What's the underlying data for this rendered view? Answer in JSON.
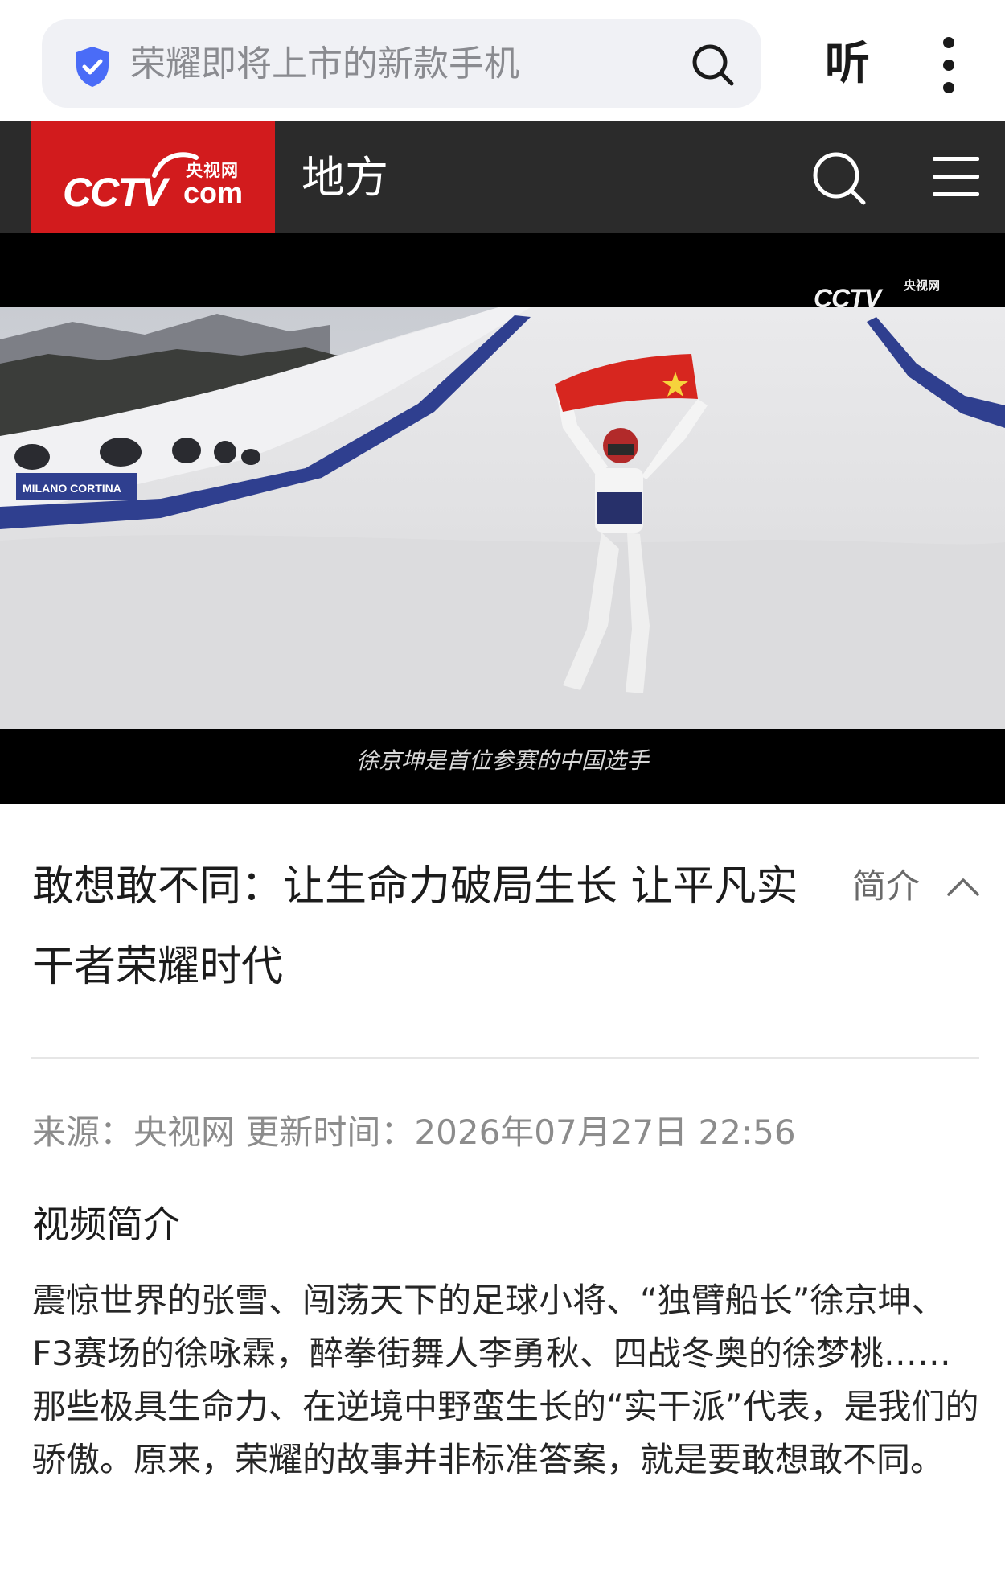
{
  "browser": {
    "search_text": "荣耀即将上市的新款手机",
    "listen_label": "听",
    "icons": [
      "shield-check-icon",
      "search-icon",
      "more-vertical-icon"
    ],
    "accent_color": "#4a6cf7"
  },
  "header": {
    "logo_cn": "央视网",
    "logo_wordmark": "CCTV",
    "logo_com": "com",
    "channel_title": "地方",
    "brand_color": "#d21b1d",
    "icons": [
      "search-icon",
      "menu-icon"
    ]
  },
  "video": {
    "watermark_wordmark": "CCTV",
    "watermark_cn": "央视网",
    "caption": "徐京坤是首位参赛的中国选手"
  },
  "article": {
    "title": "敢想敢不同：让生命力破局生长 让平凡实干者荣耀时代",
    "intro_toggle_label": "简介",
    "meta": {
      "source_label": "来源：",
      "source": "央视网",
      "updated_label": "更新时间：",
      "updated": "2026年07月27日 22:56"
    },
    "section_heading": "视频简介",
    "description": "震惊世界的张雪、闯荡天下的足球小将、“独臂船长”徐京坤、F3赛场的徐咏霖，醉拳街舞人李勇秋、四战冬奥的徐梦桃……那些极具生命力、在逆境中野蛮生长的“实干派”代表，是我们的骄傲。原来，荣耀的故事并非标准答案，就是要敢想敢不同。"
  }
}
